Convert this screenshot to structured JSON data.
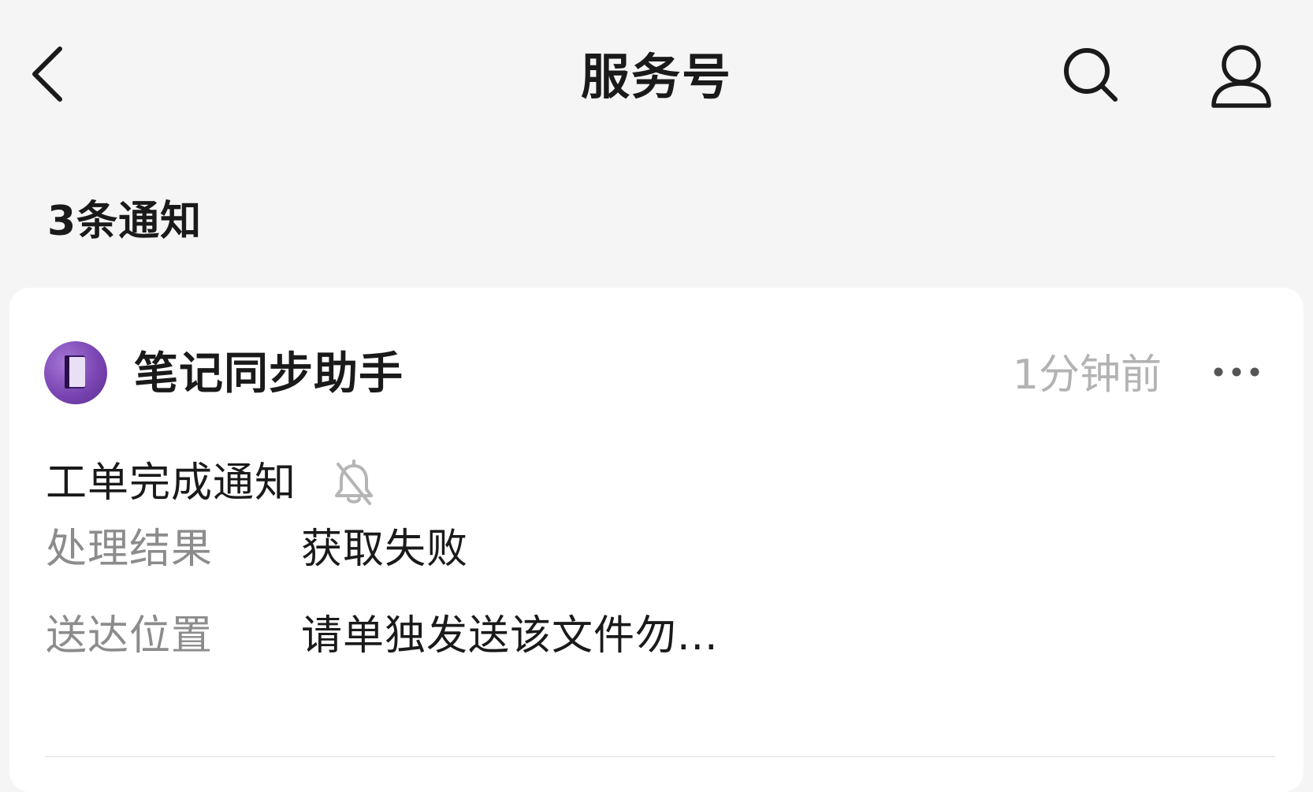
{
  "header": {
    "title": "服务号"
  },
  "section": {
    "count_label": "3条通知"
  },
  "notification": {
    "sender": "笔记同步助手",
    "time": "1分钟前",
    "title": "工单完成通知",
    "fields": [
      {
        "label": "处理结果",
        "value": "获取失败"
      },
      {
        "label": "送达位置",
        "value": "请单独发送该文件勿..."
      }
    ]
  },
  "icons": {
    "back": "chevron-left-icon",
    "search": "search-icon",
    "profile": "user-icon",
    "more": "more-dots-icon",
    "mute": "bell-off-icon",
    "avatar": "notebook-icon"
  },
  "colors": {
    "background": "#f5f5f5",
    "card": "#ffffff",
    "avatar_purple": "#7a45b3",
    "muted_text": "#8c8c8c",
    "timestamp_text": "#b3b3b3"
  }
}
